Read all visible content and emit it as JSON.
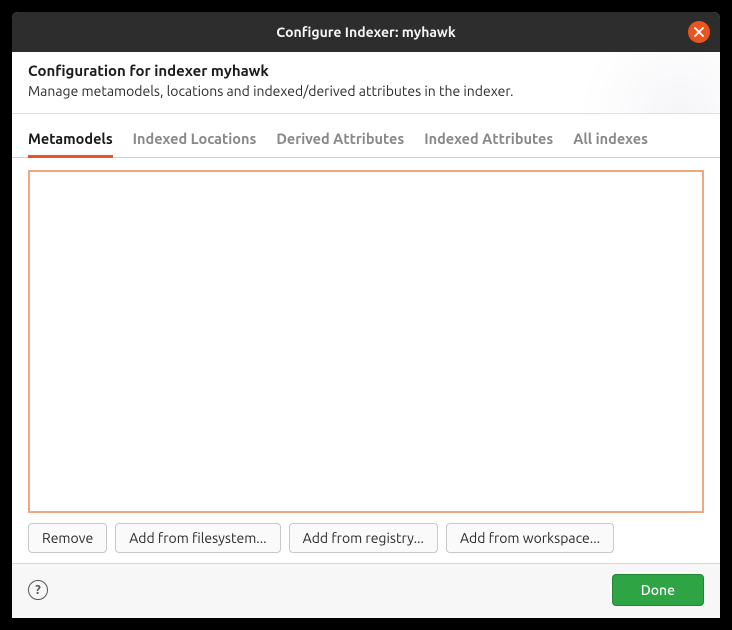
{
  "titlebar": {
    "title": "Configure Indexer: myhawk"
  },
  "header": {
    "title": "Configuration for indexer myhawk",
    "description": "Manage metamodels, locations and indexed/derived attributes in the indexer."
  },
  "tabs": [
    {
      "label": "Metamodels",
      "active": true
    },
    {
      "label": "Indexed Locations",
      "active": false
    },
    {
      "label": "Derived Attributes",
      "active": false
    },
    {
      "label": "Indexed Attributes",
      "active": false
    },
    {
      "label": "All indexes",
      "active": false
    }
  ],
  "buttons": {
    "remove": "Remove",
    "add_filesystem": "Add from filesystem...",
    "add_registry": "Add from registry...",
    "add_workspace": "Add from workspace..."
  },
  "footer": {
    "help_glyph": "?",
    "done": "Done"
  },
  "colors": {
    "accent": "#e95420",
    "done_bg": "#2ea444",
    "listbox_border": "#f1a583"
  }
}
